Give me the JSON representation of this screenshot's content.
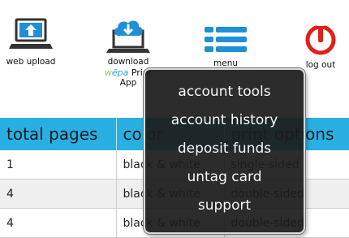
{
  "toolbar": {
    "web_upload": {
      "label": "web upload",
      "icon": "laptop-upload-icon"
    },
    "download": {
      "label": "download",
      "brand_w": "w",
      "brand_epa": "ēpa",
      "app_suffix": "Print",
      "app_line2": "App",
      "icon": "laptop-cloud-download-icon"
    },
    "menu": {
      "label": "menu",
      "icon": "stack-menu-icon"
    },
    "logout": {
      "label": "log out",
      "icon": "power-icon"
    }
  },
  "table": {
    "headers": [
      "total pages",
      "color",
      "print options"
    ],
    "rows": [
      [
        "1",
        "black & white",
        "single-sided"
      ],
      [
        "4",
        "black & white",
        "double-sided"
      ],
      [
        "4",
        "black & white",
        "double-sided"
      ]
    ]
  },
  "menu_popup": {
    "items": [
      "account tools",
      "account history",
      "deposit funds",
      "untag card",
      "support"
    ]
  },
  "colors": {
    "accent_blue": "#29b0e3",
    "icon_blue": "#1f8fd6",
    "logout_red": "#e0201b",
    "popup_bg": "#1c1c1c"
  }
}
